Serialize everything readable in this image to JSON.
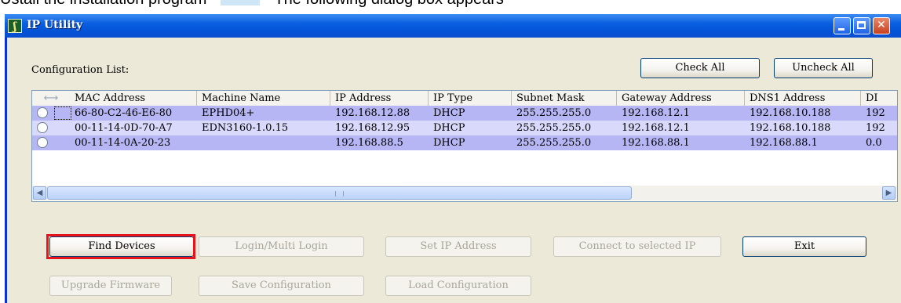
{
  "caption": {
    "before": "Ustall the installation program",
    "after": "The following dialog box appears"
  },
  "window": {
    "title": "IP Utility",
    "icon_glyph": "ʃ"
  },
  "config_label": "Configuration List:",
  "buttons": {
    "check_all": "Check All",
    "uncheck_all": "Uncheck All",
    "find_devices": "Find Devices",
    "login": "Login/Multi Login",
    "set_ip": "Set IP Address",
    "connect": "Connect to selected IP",
    "exit": "Exit",
    "upgrade": "Upgrade Firmware",
    "save": "Save Configuration",
    "load": "Load Configuration"
  },
  "table": {
    "sort_icon": "⟷",
    "headers": [
      "MAC Address",
      "Machine Name",
      "IP Address",
      "IP Type",
      "Subnet Mask",
      "Gateway Address",
      "DNS1 Address",
      "DI"
    ],
    "rows": [
      [
        "66-80-C2-46-E6-80",
        "EPHD04+",
        "192.168.12.88",
        "DHCP",
        "255.255.255.0",
        "192.168.12.1",
        "192.168.10.188",
        "192"
      ],
      [
        "00-11-14-0D-70-A7",
        "EDN3160-1.0.15",
        "192.168.12.95",
        "DHCP",
        "255.255.255.0",
        "192.168.12.1",
        "192.168.10.188",
        "192"
      ],
      [
        "00-11-14-0A-20-23",
        "",
        "192.168.88.5",
        "DHCP",
        "255.255.255.0",
        "192.168.88.1",
        "192.168.88.1",
        "0.0"
      ]
    ]
  },
  "scroll": {
    "grip": "|||",
    "left_arrow": "◀",
    "right_arrow": "▶"
  },
  "colors": {
    "row_odd": "#b6b6f4",
    "row_even": "#d9d9fb",
    "highlight_border": "#e8141b",
    "titlebar": "#0453d8"
  }
}
